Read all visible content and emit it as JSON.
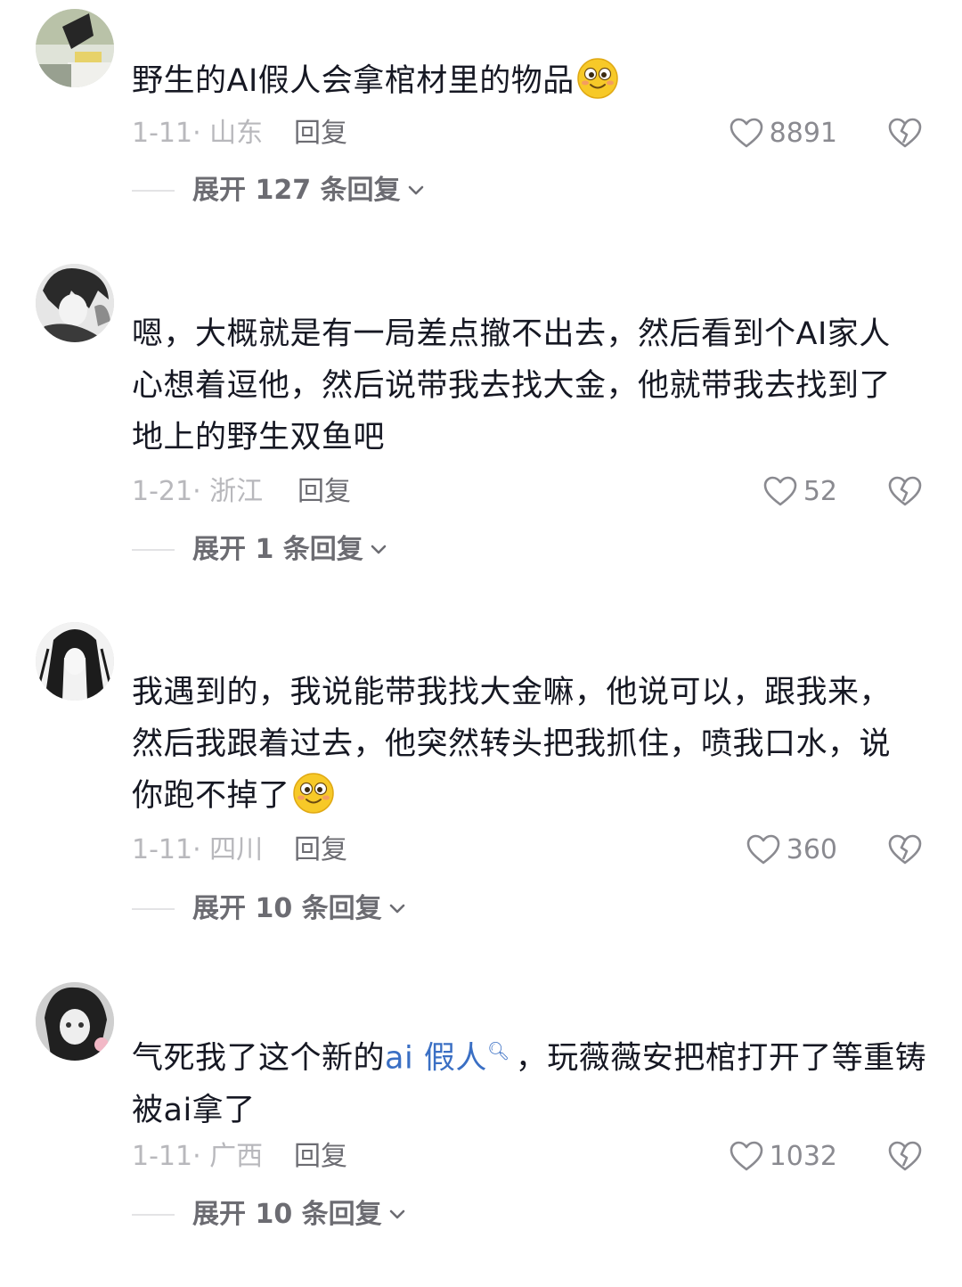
{
  "comments": [
    {
      "text": "野生的AI假人会拿棺材里的物品",
      "has_emoji": true,
      "date": "1-11· 山东",
      "reply": "回复",
      "likes": "8891",
      "expand": "展开 127 条回复"
    },
    {
      "lines": [
        "嗯，大概就是有一局差点撤不出去，然后看到个AI家人",
        "心想着逗他，然后说带我去找大金，他就带我去找到了",
        "地上的野生双鱼吧"
      ],
      "date": "1-21· 浙江",
      "reply": "回复",
      "likes": "52",
      "expand": "展开 1 条回复"
    },
    {
      "lines": [
        "我遇到的，我说能带我找大金嘛，他说可以，跟我来，",
        "然后我跟着过去，他突然转头把我抓住，喷我口水，说",
        "你跑不掉了"
      ],
      "has_emoji": true,
      "date": "1-11· 四川",
      "reply": "回复",
      "likes": "360",
      "expand": "展开 10 条回复"
    },
    {
      "line1_pre": "气死我了这个新的",
      "line1_link": "ai 假人",
      "line1_post": "，玩薇薇安把棺打开了等重铸",
      "line2": "被ai拿了",
      "date": "1-11· 广西",
      "reply": "回复",
      "likes": "1032",
      "expand": "展开 10 条回复"
    }
  ]
}
